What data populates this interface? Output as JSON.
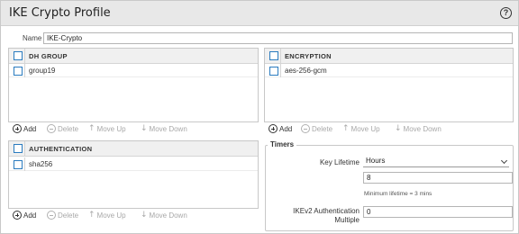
{
  "dialog": {
    "title": "IKE Crypto Profile",
    "help_icon": "question-circle-icon",
    "help_glyph": "?"
  },
  "name_field": {
    "label": "Name",
    "value": "IKE-Crypto"
  },
  "dh_group": {
    "header": "DH GROUP",
    "rows": [
      "group19"
    ]
  },
  "encryption": {
    "header": "ENCRYPTION",
    "rows": [
      "aes-256-gcm"
    ]
  },
  "authentication": {
    "header": "AUTHENTICATION",
    "rows": [
      "sha256"
    ]
  },
  "toolbar": {
    "add": "Add",
    "delete": "Delete",
    "move_up": "Move Up",
    "move_down": "Move Down"
  },
  "timers": {
    "legend": "Timers",
    "key_lifetime_label": "Key Lifetime",
    "key_lifetime_unit": "Hours",
    "key_lifetime_value": "8",
    "key_lifetime_hint": "Minimum lifetime = 3 mins",
    "ikev2_label_line1": "IKEv2 Authentication",
    "ikev2_label_line2": "Multiple",
    "ikev2_value": "0"
  },
  "colors": {
    "checkbox_border": "#2a7bbf",
    "title_bar": "#e8e8e8",
    "disabled_text": "#a8a8a8"
  }
}
